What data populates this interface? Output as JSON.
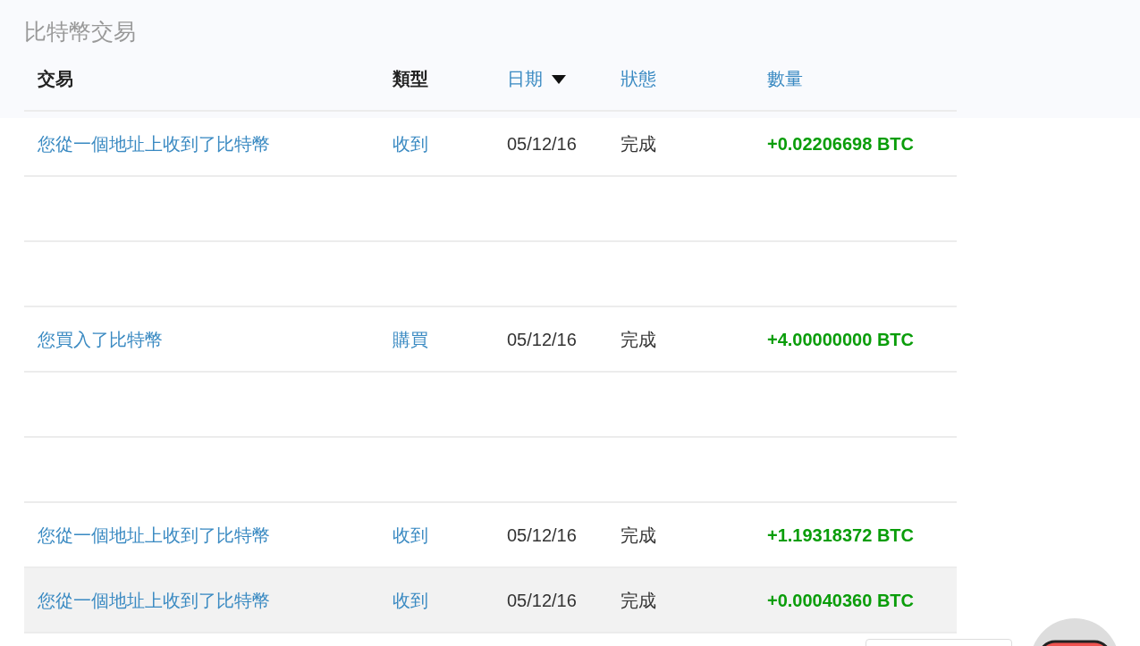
{
  "title": "比特幣交易",
  "table": {
    "columns": [
      {
        "label": "交易",
        "sortable": false,
        "sorted": false
      },
      {
        "label": "類型",
        "sortable": false,
        "sorted": false
      },
      {
        "label": "日期",
        "sortable": true,
        "sorted": true
      },
      {
        "label": "狀態",
        "sortable": true,
        "sorted": false
      },
      {
        "label": "數量",
        "sortable": true,
        "sorted": false
      }
    ],
    "rows": [
      {
        "kind": "transaction",
        "selected": false,
        "description": "您從一個地址上收到了比特幣",
        "type": "收到",
        "date": "05/12/16",
        "status": "完成",
        "amount": "+0.02206698 BTC"
      },
      {
        "kind": "empty",
        "selected": false
      },
      {
        "kind": "empty",
        "selected": false
      },
      {
        "kind": "transaction",
        "selected": false,
        "description": "您買入了比特幣",
        "type": "購買",
        "date": "05/12/16",
        "status": "完成",
        "amount": "+4.00000000 BTC"
      },
      {
        "kind": "empty",
        "selected": false
      },
      {
        "kind": "empty",
        "selected": false
      },
      {
        "kind": "transaction",
        "selected": false,
        "description": "您從一個地址上收到了比特幣",
        "type": "收到",
        "date": "05/12/16",
        "status": "完成",
        "amount": "+1.19318372 BTC"
      },
      {
        "kind": "transaction",
        "selected": true,
        "description": "您從一個地址上收到了比特幣",
        "type": "收到",
        "date": "05/12/16",
        "status": "完成",
        "amount": "+0.00040360 BTC"
      }
    ]
  }
}
